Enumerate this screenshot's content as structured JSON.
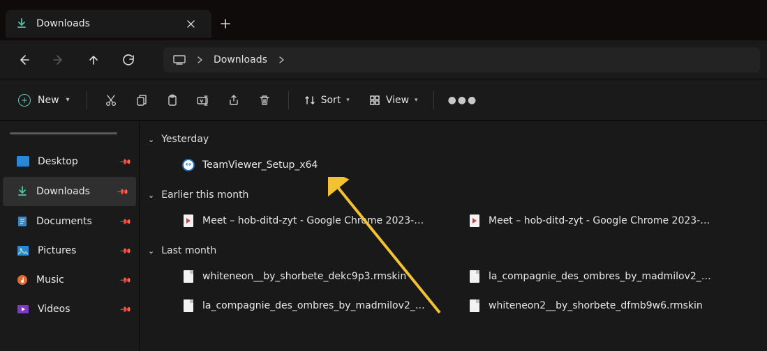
{
  "tab": {
    "title": "Downloads"
  },
  "breadcrumb": {
    "root_icon": "this-pc",
    "items": [
      "Downloads"
    ]
  },
  "toolbar": {
    "new_label": "New",
    "sort_label": "Sort",
    "view_label": "View"
  },
  "sidebar": {
    "items": [
      {
        "label": "Desktop",
        "icon": "desktop",
        "selected": false
      },
      {
        "label": "Downloads",
        "icon": "downloads",
        "selected": true
      },
      {
        "label": "Documents",
        "icon": "documents",
        "selected": false
      },
      {
        "label": "Pictures",
        "icon": "pictures",
        "selected": false
      },
      {
        "label": "Music",
        "icon": "music",
        "selected": false
      },
      {
        "label": "Videos",
        "icon": "videos",
        "selected": false
      }
    ]
  },
  "groups": [
    {
      "label": "Yesterday",
      "files": [
        {
          "name": "TeamViewer_Setup_x64",
          "icon": "teamviewer"
        }
      ]
    },
    {
      "label": "Earlier this month",
      "files": [
        {
          "name": "Meet – hob-ditd-zyt - Google Chrome 2023-…",
          "icon": "video"
        },
        {
          "name": "Meet – hob-ditd-zyt - Google Chrome 2023-…",
          "icon": "video"
        }
      ]
    },
    {
      "label": "Last month",
      "files": [
        {
          "name": "whiteneon__by_shorbete_dekc9p3.rmskin",
          "icon": "file"
        },
        {
          "name": "la_compagnie_des_ombres_by_madmilov2_d…",
          "icon": "file"
        },
        {
          "name": "la_compagnie_des_ombres_by_madmilov2_d…",
          "icon": "file"
        },
        {
          "name": "whiteneon2__by_shorbete_dfmb9w6.rmskin",
          "icon": "file"
        }
      ]
    }
  ]
}
